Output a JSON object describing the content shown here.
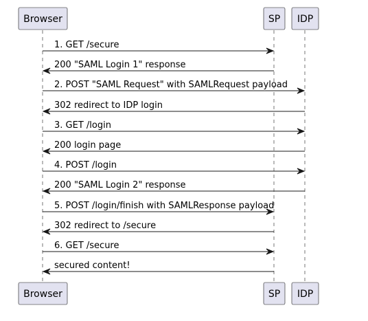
{
  "participants": [
    {
      "id": "browser",
      "label": "Browser"
    },
    {
      "id": "sp",
      "label": "SP"
    },
    {
      "id": "idp",
      "label": "IDP"
    }
  ],
  "messages": [
    {
      "from": "browser",
      "to": "sp",
      "label": "1. GET /secure"
    },
    {
      "from": "sp",
      "to": "browser",
      "label": "200 \"SAML Login 1\" response"
    },
    {
      "from": "browser",
      "to": "idp",
      "label": "2. POST \"SAML Request\" with SAMLRequest payload"
    },
    {
      "from": "idp",
      "to": "browser",
      "label": "302 redirect to IDP login"
    },
    {
      "from": "browser",
      "to": "idp",
      "label": "3. GET /login"
    },
    {
      "from": "idp",
      "to": "browser",
      "label": "200 login page"
    },
    {
      "from": "browser",
      "to": "idp",
      "label": "4. POST /login"
    },
    {
      "from": "idp",
      "to": "browser",
      "label": "200 \"SAML Login 2\" response"
    },
    {
      "from": "browser",
      "to": "sp",
      "label": "5. POST /login/finish with SAMLResponse payload"
    },
    {
      "from": "sp",
      "to": "browser",
      "label": "302 redirect to /secure"
    },
    {
      "from": "browser",
      "to": "sp",
      "label": "6. GET /secure"
    },
    {
      "from": "sp",
      "to": "browser",
      "label": "secured content!"
    }
  ]
}
